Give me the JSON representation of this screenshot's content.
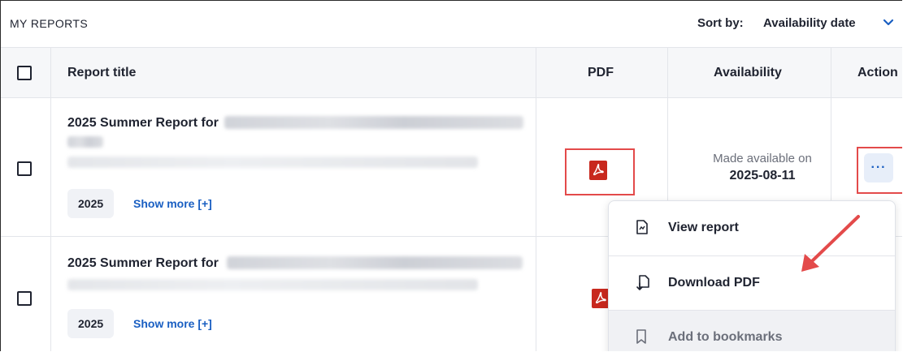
{
  "header": {
    "title": "MY REPORTS",
    "sort_label": "Sort by:",
    "sort_value": "Availability date"
  },
  "columns": {
    "title": "Report title",
    "pdf": "PDF",
    "availability": "Availability",
    "action": "Action"
  },
  "rows": [
    {
      "title": "2025 Summer Report for",
      "year_tag": "2025",
      "show_more": "Show more [+]",
      "availability_label": "Made available on",
      "availability_date": "2025-08-11"
    },
    {
      "title": "2025 Summer Report for",
      "year_tag": "2025",
      "show_more": "Show more [+]"
    }
  ],
  "action_menu": {
    "button_label": "···",
    "items": [
      {
        "label": "View report",
        "icon": "document-icon"
      },
      {
        "label": "Download PDF",
        "icon": "download-pdf-icon"
      },
      {
        "label": "Add to bookmarks",
        "icon": "bookmark-icon"
      }
    ]
  },
  "colors": {
    "accent": "#1a5fc2",
    "pdf_red": "#c8281e",
    "highlight_red": "#e34a4a"
  }
}
